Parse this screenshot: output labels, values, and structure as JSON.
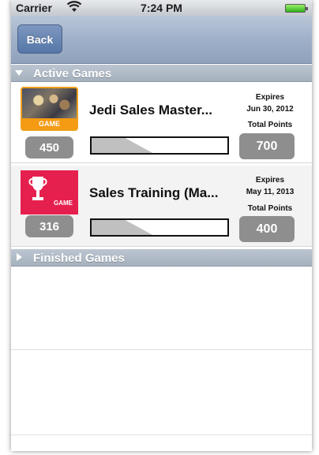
{
  "status_bar": {
    "carrier": "Carrier",
    "time": "7:24 PM"
  },
  "nav_bar": {
    "back_label": "Back"
  },
  "sections": {
    "active": {
      "label": "Active Games",
      "expanded": true
    },
    "finished": {
      "label": "Finished Games",
      "expanded": false
    }
  },
  "games": [
    {
      "title": "Jedi Sales Master...",
      "icon": "star-wars-scene-icon",
      "icon_tag": "GAME",
      "points": "450",
      "progress": 0.45,
      "expires_label": "Expires",
      "expires_date": "Jun 30, 2012",
      "total_label": "Total Points",
      "total_points": "700"
    },
    {
      "title": "Sales Training (Ma...",
      "icon": "trophy-icon",
      "icon_tag": "GAME",
      "points": "316",
      "progress": 0.45,
      "expires_label": "Expires",
      "expires_date": "May 11, 2013",
      "total_label": "Total Points",
      "total_points": "400"
    }
  ],
  "colors": {
    "nav_bar": "#9fb0c8",
    "back_button": "#5577a8",
    "section_header": "#b0bbc7",
    "badge": "#8e8e8e",
    "icon_1_accent": "#f59a13",
    "icon_2_bg": "#e6204e"
  }
}
